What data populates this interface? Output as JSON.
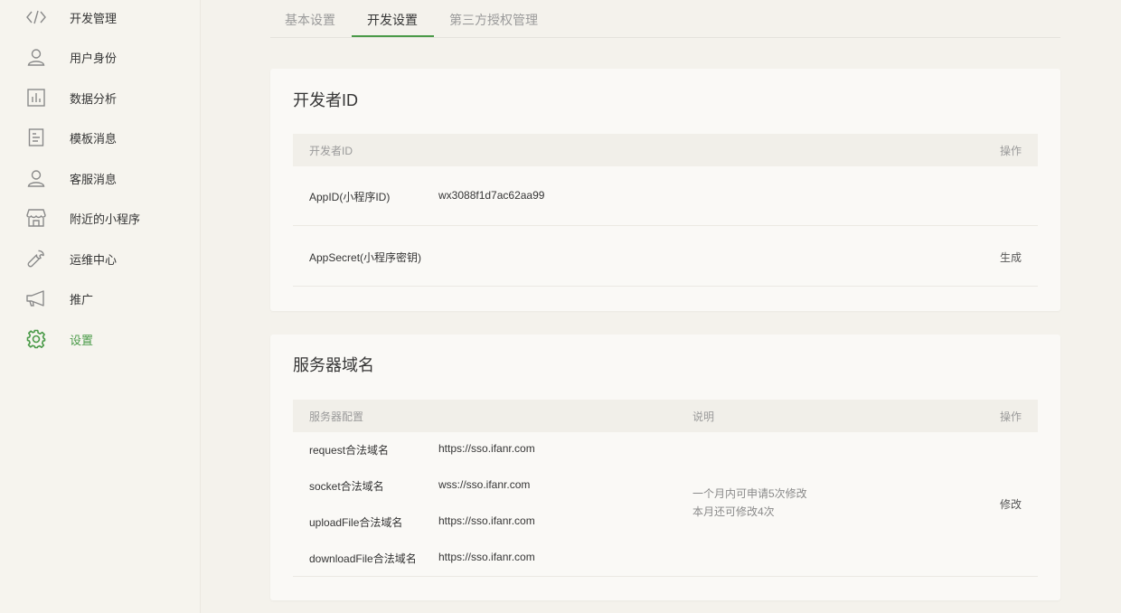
{
  "sidebar": {
    "items": [
      {
        "label": "开发管理",
        "icon": "code-icon"
      },
      {
        "label": "用户身份",
        "icon": "user-icon"
      },
      {
        "label": "数据分析",
        "icon": "chart-icon"
      },
      {
        "label": "模板消息",
        "icon": "document-icon"
      },
      {
        "label": "客服消息",
        "icon": "support-user-icon"
      },
      {
        "label": "附近的小程序",
        "icon": "store-icon"
      },
      {
        "label": "运维中心",
        "icon": "wrench-icon"
      },
      {
        "label": "推广",
        "icon": "megaphone-icon"
      },
      {
        "label": "设置",
        "icon": "gear-icon",
        "active": true
      }
    ]
  },
  "tabs": [
    {
      "label": "基本设置"
    },
    {
      "label": "开发设置",
      "active": true
    },
    {
      "label": "第三方授权管理"
    }
  ],
  "developer_card": {
    "title": "开发者ID",
    "headers": {
      "name": "开发者ID",
      "action": "操作"
    },
    "rows": [
      {
        "label": "AppID(小程序ID)",
        "value": "wx3088f1d7ac62aa99",
        "action": ""
      },
      {
        "label": "AppSecret(小程序密钥)",
        "value": "",
        "action": "生成"
      }
    ]
  },
  "server_card": {
    "title": "服务器域名",
    "headers": {
      "config": "服务器配置",
      "desc": "说明",
      "action": "操作"
    },
    "rows": [
      {
        "label": "request合法域名",
        "value": "https://sso.ifanr.com"
      },
      {
        "label": "socket合法域名",
        "value": "wss://sso.ifanr.com"
      },
      {
        "label": "uploadFile合法域名",
        "value": "https://sso.ifanr.com"
      },
      {
        "label": "downloadFile合法域名",
        "value": "https://sso.ifanr.com"
      }
    ],
    "note_line1": "一个月内可申请5次修改",
    "note_line2": "本月还可修改4次",
    "action": "修改"
  },
  "colors": {
    "accent": "#4a9a48",
    "background": "#f4f2ec",
    "card": "#faf9f6"
  }
}
